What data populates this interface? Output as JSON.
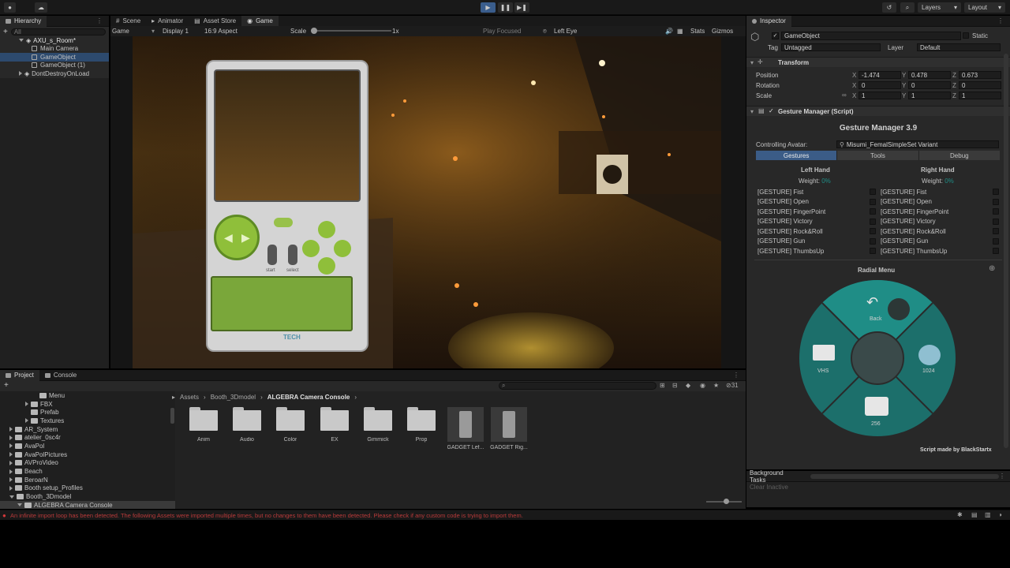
{
  "toolbar": {
    "layers": "Layers",
    "layout": "Layout"
  },
  "hierarchy": {
    "tab": "Hierarchy",
    "search_placeholder": "All",
    "items": [
      {
        "label": "AXU_s_Room*",
        "depth": 0
      },
      {
        "label": "Main Camera",
        "depth": 1
      },
      {
        "label": "GameObject",
        "depth": 1
      },
      {
        "label": "GameObject (1)",
        "depth": 1
      },
      {
        "label": "DontDestroyOnLoad",
        "depth": 0
      }
    ]
  },
  "center_tabs": [
    "Scene",
    "Animator",
    "Asset Store",
    "Game"
  ],
  "gamebar": {
    "mode": "Game",
    "display": "Display 1",
    "aspect": "16:9 Aspect",
    "scale_label": "Scale",
    "scale_value": "1x",
    "play_focused": "Play Focused",
    "eye": "Left Eye",
    "stats": "Stats",
    "gizmos": "Gizmos"
  },
  "device": {
    "btn_left": "start",
    "btn_right": "select",
    "brand": "TECH"
  },
  "inspector": {
    "tab": "Inspector",
    "name": "GameObject",
    "static_label": "Static",
    "tag_label": "Tag",
    "tag_value": "Untagged",
    "layer_label": "Layer",
    "layer_value": "Default",
    "transform_title": "Transform",
    "position_label": "Position",
    "rotation_label": "Rotation",
    "scale_label": "Scale",
    "position": {
      "x": "-1.474",
      "y": "0.478",
      "z": "0.673"
    },
    "rotation": {
      "x": "0",
      "y": "0",
      "z": "0"
    },
    "scale": {
      "x": "1",
      "y": "1",
      "z": "1"
    },
    "component_title": "Gesture Manager (Script)",
    "gm_title": "Gesture Manager 3.9",
    "controlling_label": "Controlling Avatar:",
    "controlling_value": "Misumi_FemalSimpleSet Variant",
    "tabs": [
      "Gestures",
      "Tools",
      "Debug"
    ],
    "left_hand": "Left Hand",
    "right_hand": "Right Hand",
    "weight_label": "Weight:",
    "weight_value": "0%",
    "gestures": [
      "[GESTURE] Fist",
      "[GESTURE] Open",
      "[GESTURE] FingerPoint",
      "[GESTURE] Victory",
      "[GESTURE] Rock&Roll",
      "[GESTURE] Gun",
      "[GESTURE] ThumbsUp"
    ],
    "radial_title": "Radial Menu",
    "radial_items": {
      "top": "Back",
      "left": "VHS",
      "right": "1024",
      "bottom": "256"
    },
    "credit": "Script made by BlackStartx"
  },
  "bg_tasks": {
    "title": "Background Tasks",
    "item": "Clear Inactive"
  },
  "project": {
    "tabs": [
      "Project",
      "Console"
    ],
    "tree": [
      {
        "label": "Menu",
        "depth": 4
      },
      {
        "label": "FBX",
        "depth": 3
      },
      {
        "label": "Prefab",
        "depth": 3
      },
      {
        "label": "Textures",
        "depth": 3
      },
      {
        "label": "AR_System",
        "depth": 1
      },
      {
        "label": "atelier_0sc4r",
        "depth": 1
      },
      {
        "label": "AvaPol",
        "depth": 1
      },
      {
        "label": "AvaPolPictures",
        "depth": 1
      },
      {
        "label": "AVProVideo",
        "depth": 1
      },
      {
        "label": "Beach",
        "depth": 1
      },
      {
        "label": "BeroarN",
        "depth": 1
      },
      {
        "label": "Booth setup_Profiles",
        "depth": 1
      },
      {
        "label": "Booth_3Dmodel",
        "depth": 1
      },
      {
        "label": "ALGEBRA Camera Console",
        "depth": 2
      }
    ],
    "breadcrumb": [
      "Assets",
      "Booth_3Dmodel",
      "ALGEBRA Camera Console"
    ],
    "hidden_count": "31",
    "assets": [
      "Anim",
      "Audio",
      "Color",
      "EX",
      "Gimmick",
      "Prop",
      "GADGET Lef...",
      "GADGET Rig..."
    ]
  },
  "status": {
    "message": "An infinite import loop has been detected. The following Assets were imported multiple times, but no changes to them have been detected. Please check if any custom code is trying to import them."
  },
  "colors": {
    "accent": "#2d4a6e",
    "teal": "#1f8d86",
    "error": "#d2383a"
  }
}
